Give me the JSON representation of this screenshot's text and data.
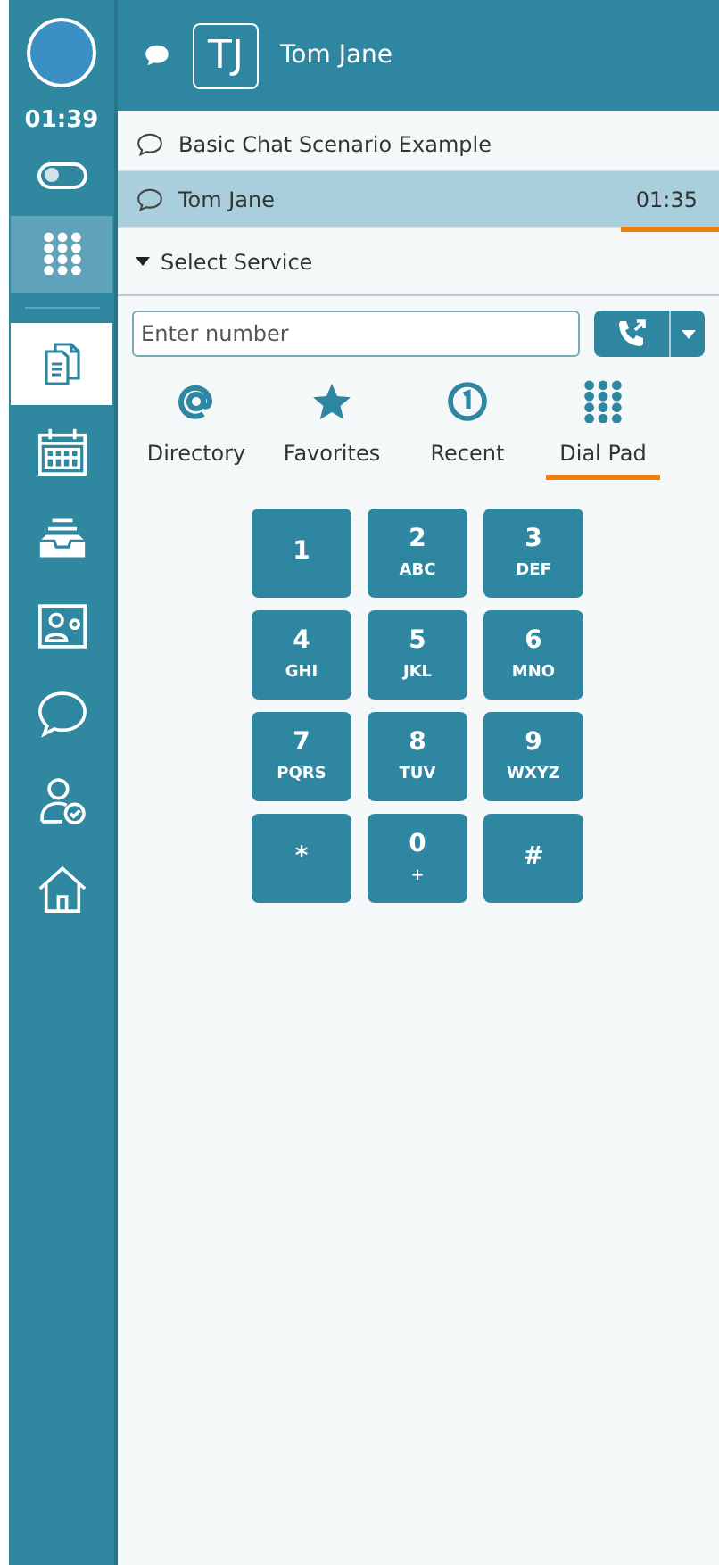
{
  "header": {
    "initials": "TJ",
    "name": "Tom Jane"
  },
  "sidebar": {
    "clock": "01:39",
    "toggle": {
      "on": false
    },
    "dialpad_active": true,
    "items": [
      {
        "kind": "documents",
        "selected": true
      },
      {
        "kind": "calendar",
        "selected": false
      },
      {
        "kind": "inbox",
        "selected": false
      },
      {
        "kind": "contact",
        "selected": false
      },
      {
        "kind": "chat",
        "selected": false
      },
      {
        "kind": "user",
        "selected": false
      },
      {
        "kind": "home",
        "selected": false
      }
    ]
  },
  "conversations": [
    {
      "title": "Basic Chat Scenario Example",
      "selected": false
    },
    {
      "title": "Tom Jane",
      "timer": "01:35",
      "selected": true
    }
  ],
  "service": {
    "label": "Select Service",
    "expanded": true
  },
  "number_field": {
    "placeholder": "Enter number"
  },
  "tabs": [
    {
      "kind": "directory",
      "label": "Directory",
      "selected": false
    },
    {
      "kind": "favorites",
      "label": "Favorites",
      "selected": false
    },
    {
      "kind": "recent",
      "label": "Recent",
      "selected": false
    },
    {
      "kind": "dialpad",
      "label": "Dial Pad",
      "selected": true
    }
  ],
  "keys": [
    {
      "digit": "1"
    },
    {
      "digit": "2",
      "letters": "ABC"
    },
    {
      "digit": "3",
      "letters": "DEF"
    },
    {
      "digit": "4",
      "letters": "GHI"
    },
    {
      "digit": "5",
      "letters": "JKL"
    },
    {
      "digit": "6",
      "letters": "MNO"
    },
    {
      "digit": "7",
      "letters": "PQRS"
    },
    {
      "digit": "8",
      "letters": "TUV"
    },
    {
      "digit": "9",
      "letters": "WXYZ"
    },
    {
      "digit": "*"
    },
    {
      "digit": "0",
      "letters": "+"
    },
    {
      "digit": "#"
    }
  ]
}
